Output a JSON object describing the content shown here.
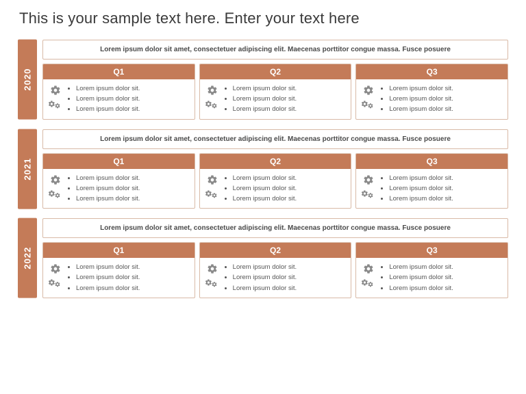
{
  "title": "This is your sample text here. Enter your text here",
  "summary_text": "Lorem ipsum dolor sit amet, consectetuer adipiscing elit. Maecenas porttitor congue massa. Fusce posuere",
  "bullet_text": "Lorem ipsum dolor sit.",
  "years": [
    {
      "label": "2020",
      "quarters": [
        "Q1",
        "Q2",
        "Q3"
      ]
    },
    {
      "label": "2021",
      "quarters": [
        "Q1",
        "Q2",
        "Q3"
      ]
    },
    {
      "label": "2022",
      "quarters": [
        "Q1",
        "Q2",
        "Q3"
      ]
    }
  ],
  "colors": {
    "accent": "#c47b58"
  }
}
